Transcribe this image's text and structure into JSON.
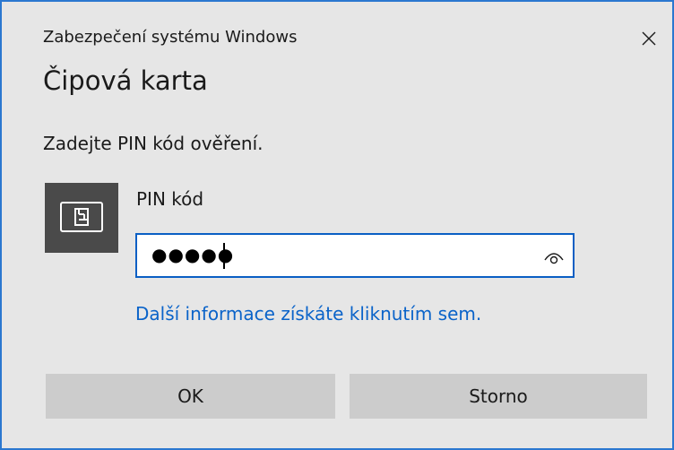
{
  "window": {
    "title": "Zabezpečení systému Windows",
    "close_icon": "close-icon"
  },
  "dialog": {
    "heading": "Čipová karta",
    "prompt": "Zadejte PIN kód ověření.",
    "card_icon": "smart-card-icon"
  },
  "pin": {
    "label": "PIN kód",
    "value": "●●●●●",
    "reveal_icon": "eye-icon"
  },
  "link": {
    "more_info": "Další informace získáte kliknutím sem."
  },
  "buttons": {
    "ok": "OK",
    "cancel": "Storno"
  },
  "colors": {
    "dialog_background": "#e6e6e6",
    "window_border": "#2b78d0",
    "input_border": "#0a5fc4",
    "link": "#0a63c9",
    "card_tile": "#4a4a4a",
    "button_background": "#cccccc"
  }
}
